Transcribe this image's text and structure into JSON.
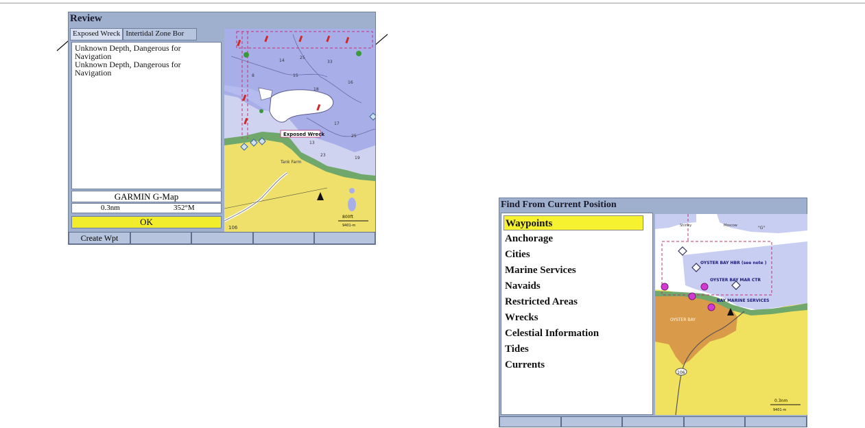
{
  "review": {
    "title": "Review",
    "tabs": [
      "Exposed Wreck",
      "Intertidal Zone Bor"
    ],
    "description": [
      "Unknown Depth, Dangerous for",
      "Navigation",
      "Unknown Depth, Dangerous for",
      "Navigation"
    ],
    "source": "GARMIN G-Map",
    "distance": "0.3nm",
    "bearing": "352°M",
    "ok_label": "OK",
    "softkeys": [
      "Create Wpt",
      "",
      "",
      "",
      ""
    ],
    "map": {
      "wreck_label": "Exposed Wreck",
      "place_label": "Tank Farm",
      "road_label": "106",
      "scale_label": "800ft",
      "scale_sub": "9401-m"
    }
  },
  "find": {
    "title": "Find From Current Position",
    "items": [
      "Waypoints",
      "Anchorage",
      "Cities",
      "Marine Services",
      "Navaids",
      "Restricted Areas",
      "Wrecks",
      "Celestial Information",
      "Tides",
      "Currents"
    ],
    "selected_index": 0,
    "softkeys": [
      "",
      "",
      "",
      "",
      ""
    ],
    "map": {
      "labels": [
        "OYSTER BAY HBR (see note )",
        "OYSTER BAY MAR CTR",
        "BAY MARINE SERVICES",
        "OYSTER BAY",
        "Shirley",
        "Moscow",
        "\"G\""
      ],
      "road_label": "106",
      "scale_label": "0.3nm",
      "scale_sub": "9401-m"
    }
  },
  "colors": {
    "panel": "#9fb0cf",
    "highlight": "#f2ed2c",
    "water_deep": "#a8aee8",
    "water_shallow": "#cfd3f0",
    "land": "#eee06a",
    "marsh": "#6fa86a",
    "urban": "#d99a4a"
  }
}
